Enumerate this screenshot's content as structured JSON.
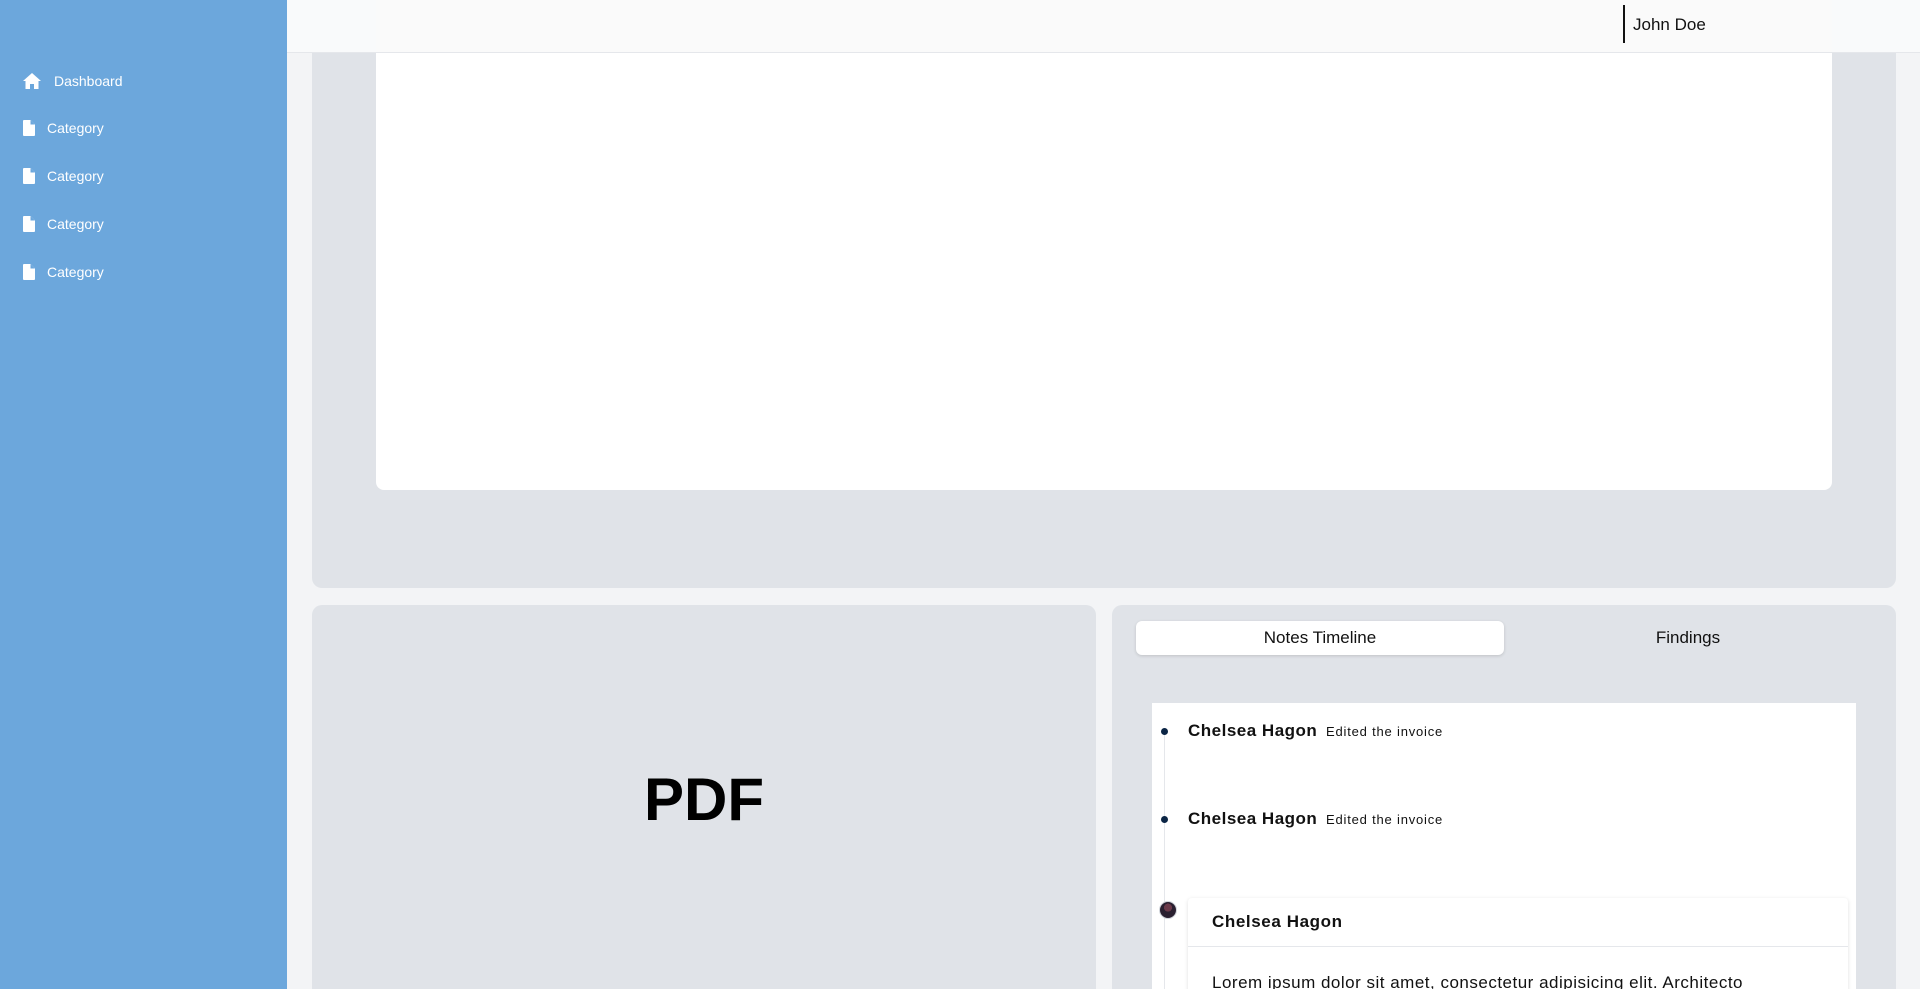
{
  "sidebar": {
    "items": [
      {
        "label": "Dashboard",
        "icon": "home-icon"
      },
      {
        "label": "Category",
        "icon": "document-icon"
      },
      {
        "label": "Category",
        "icon": "document-icon"
      },
      {
        "label": "Category",
        "icon": "document-icon"
      },
      {
        "label": "Category",
        "icon": "document-icon"
      }
    ],
    "background": "#6ca7dc"
  },
  "header": {
    "user_name": "John Doe"
  },
  "pdf_viewer": {
    "label": "PDF"
  },
  "notes": {
    "tabs": [
      {
        "label": "Notes Timeline",
        "active": true
      },
      {
        "label": "Findings",
        "active": false
      }
    ],
    "timeline": [
      {
        "name": "Chelsea Hagon",
        "action": "Edited the invoice"
      },
      {
        "name": "Chelsea Hagon",
        "action": "Edited the invoice"
      }
    ],
    "comment": {
      "name": "Chelsea Hagon",
      "text": "Lorem ipsum dolor sit amet, consectetur adipisicing elit. Architecto"
    }
  }
}
